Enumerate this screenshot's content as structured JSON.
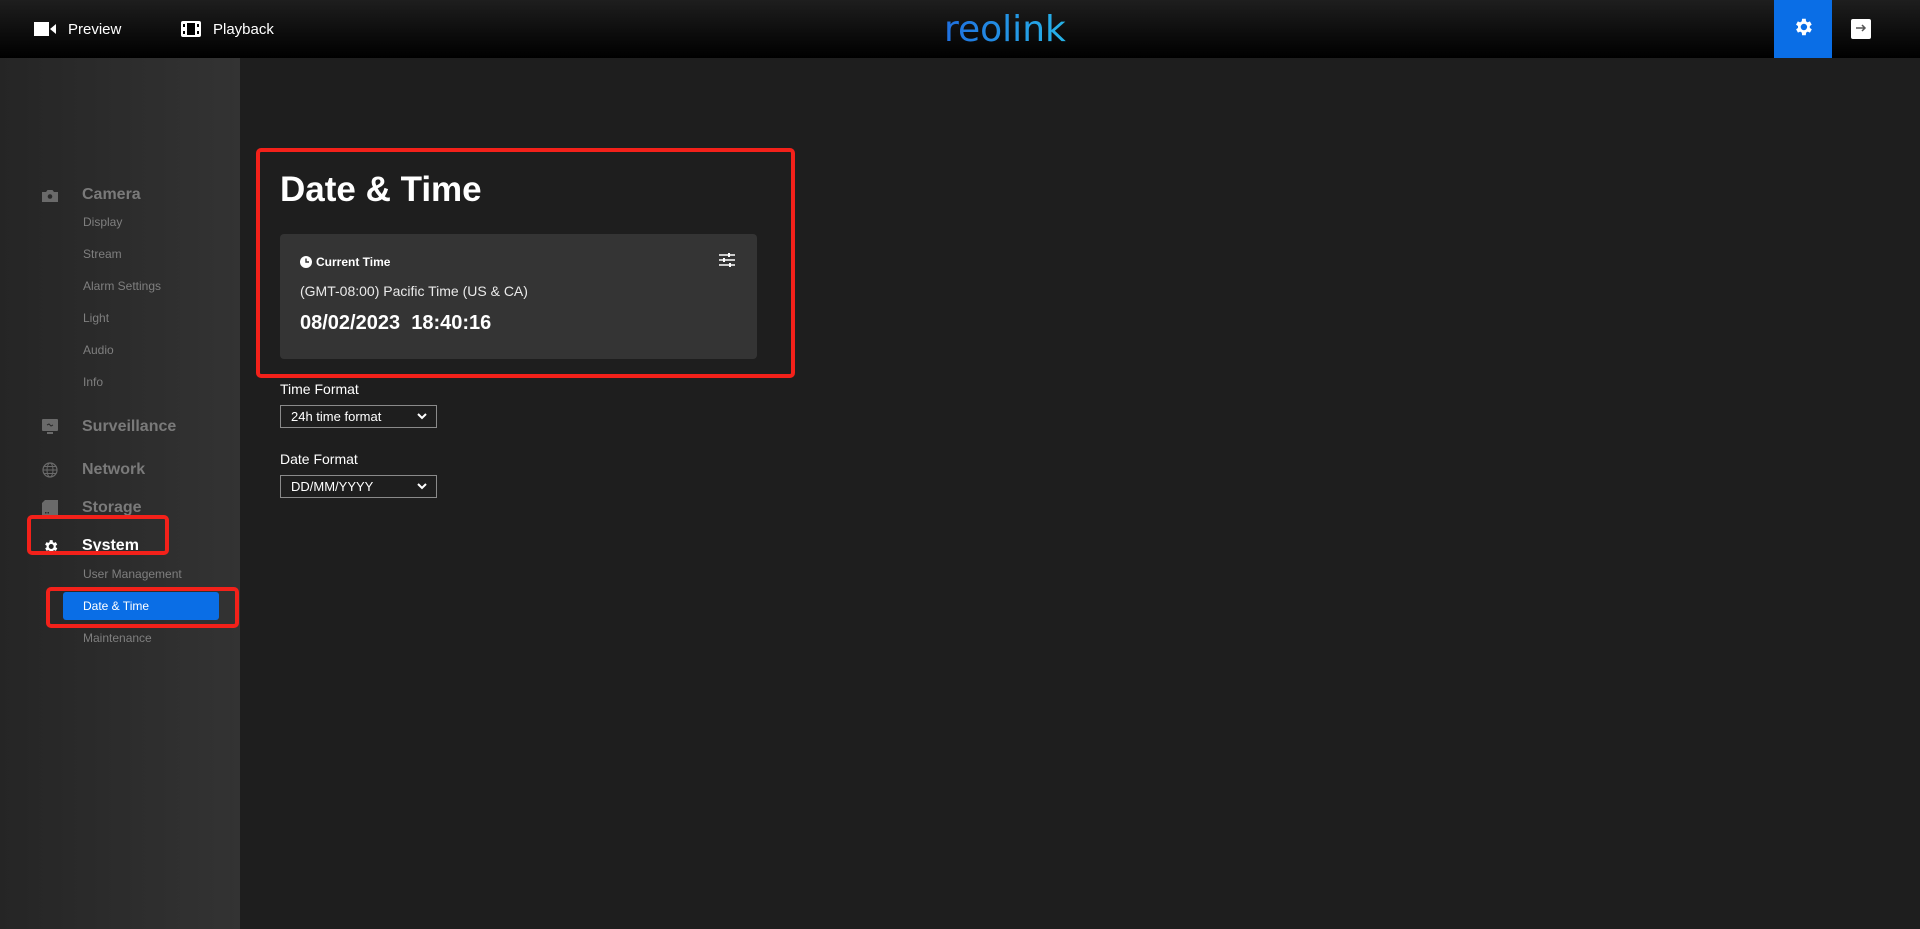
{
  "header": {
    "nav": [
      {
        "label": "Preview",
        "icon": "video-camera-icon"
      },
      {
        "label": "Playback",
        "icon": "film-icon"
      }
    ],
    "logo_text": "reolink",
    "brand_color": "#0a6ee6",
    "settings_icon": "gear-icon",
    "logout_icon": "logout-icon"
  },
  "sidebar": {
    "sections": [
      {
        "label": "Camera",
        "icon": "camera-icon",
        "items": [
          "Display",
          "Stream",
          "Alarm Settings",
          "Light",
          "Audio",
          "Info"
        ]
      },
      {
        "label": "Surveillance",
        "icon": "monitor-icon",
        "items": []
      },
      {
        "label": "Network",
        "icon": "globe-icon",
        "items": []
      },
      {
        "label": "Storage",
        "icon": "storage-icon",
        "items": []
      },
      {
        "label": "System",
        "icon": "gear-icon",
        "active": true,
        "items": [
          "User Management",
          "Date & Time",
          "Maintenance"
        ]
      }
    ],
    "active_item": "Date & Time"
  },
  "main": {
    "title": "Date & Time",
    "current_time": {
      "heading": "Current Time",
      "timezone": "(GMT-08:00) Pacific Time (US & CA)",
      "datetime": "08/02/2023  18:40:16"
    },
    "time_format": {
      "label": "Time Format",
      "value": "24h time format"
    },
    "date_format": {
      "label": "Date Format",
      "value": "DD/MM/YYYY"
    }
  },
  "annotation_color": "#f3211a"
}
